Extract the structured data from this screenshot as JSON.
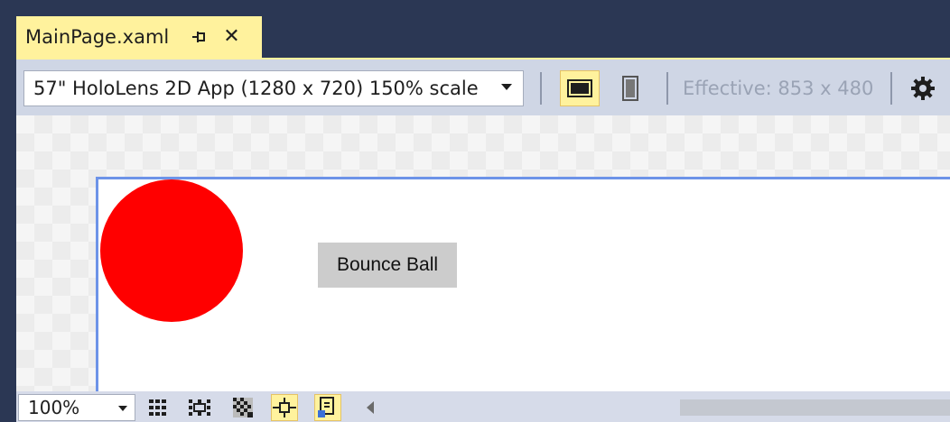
{
  "tab": {
    "title": "MainPage.xaml"
  },
  "toolbar": {
    "device": "57\" HoloLens 2D App (1280 x 720) 150% scale",
    "effective": "Effective: 853 x 480"
  },
  "canvas": {
    "button_label": "Bounce Ball",
    "ball_color": "#ff0000"
  },
  "bottombar": {
    "zoom": "100%"
  },
  "colors": {
    "frame": "#2b3754",
    "tab_active": "#fff29d",
    "toolbar": "#cfd6e5",
    "page_border": "#6d93e8"
  },
  "icons": [
    "pin-icon",
    "close-icon",
    "landscape-icon",
    "portrait-icon",
    "gear-icon",
    "grid-icon",
    "snap-icon",
    "checker-icon",
    "snap-to-points-icon",
    "document-icon"
  ]
}
